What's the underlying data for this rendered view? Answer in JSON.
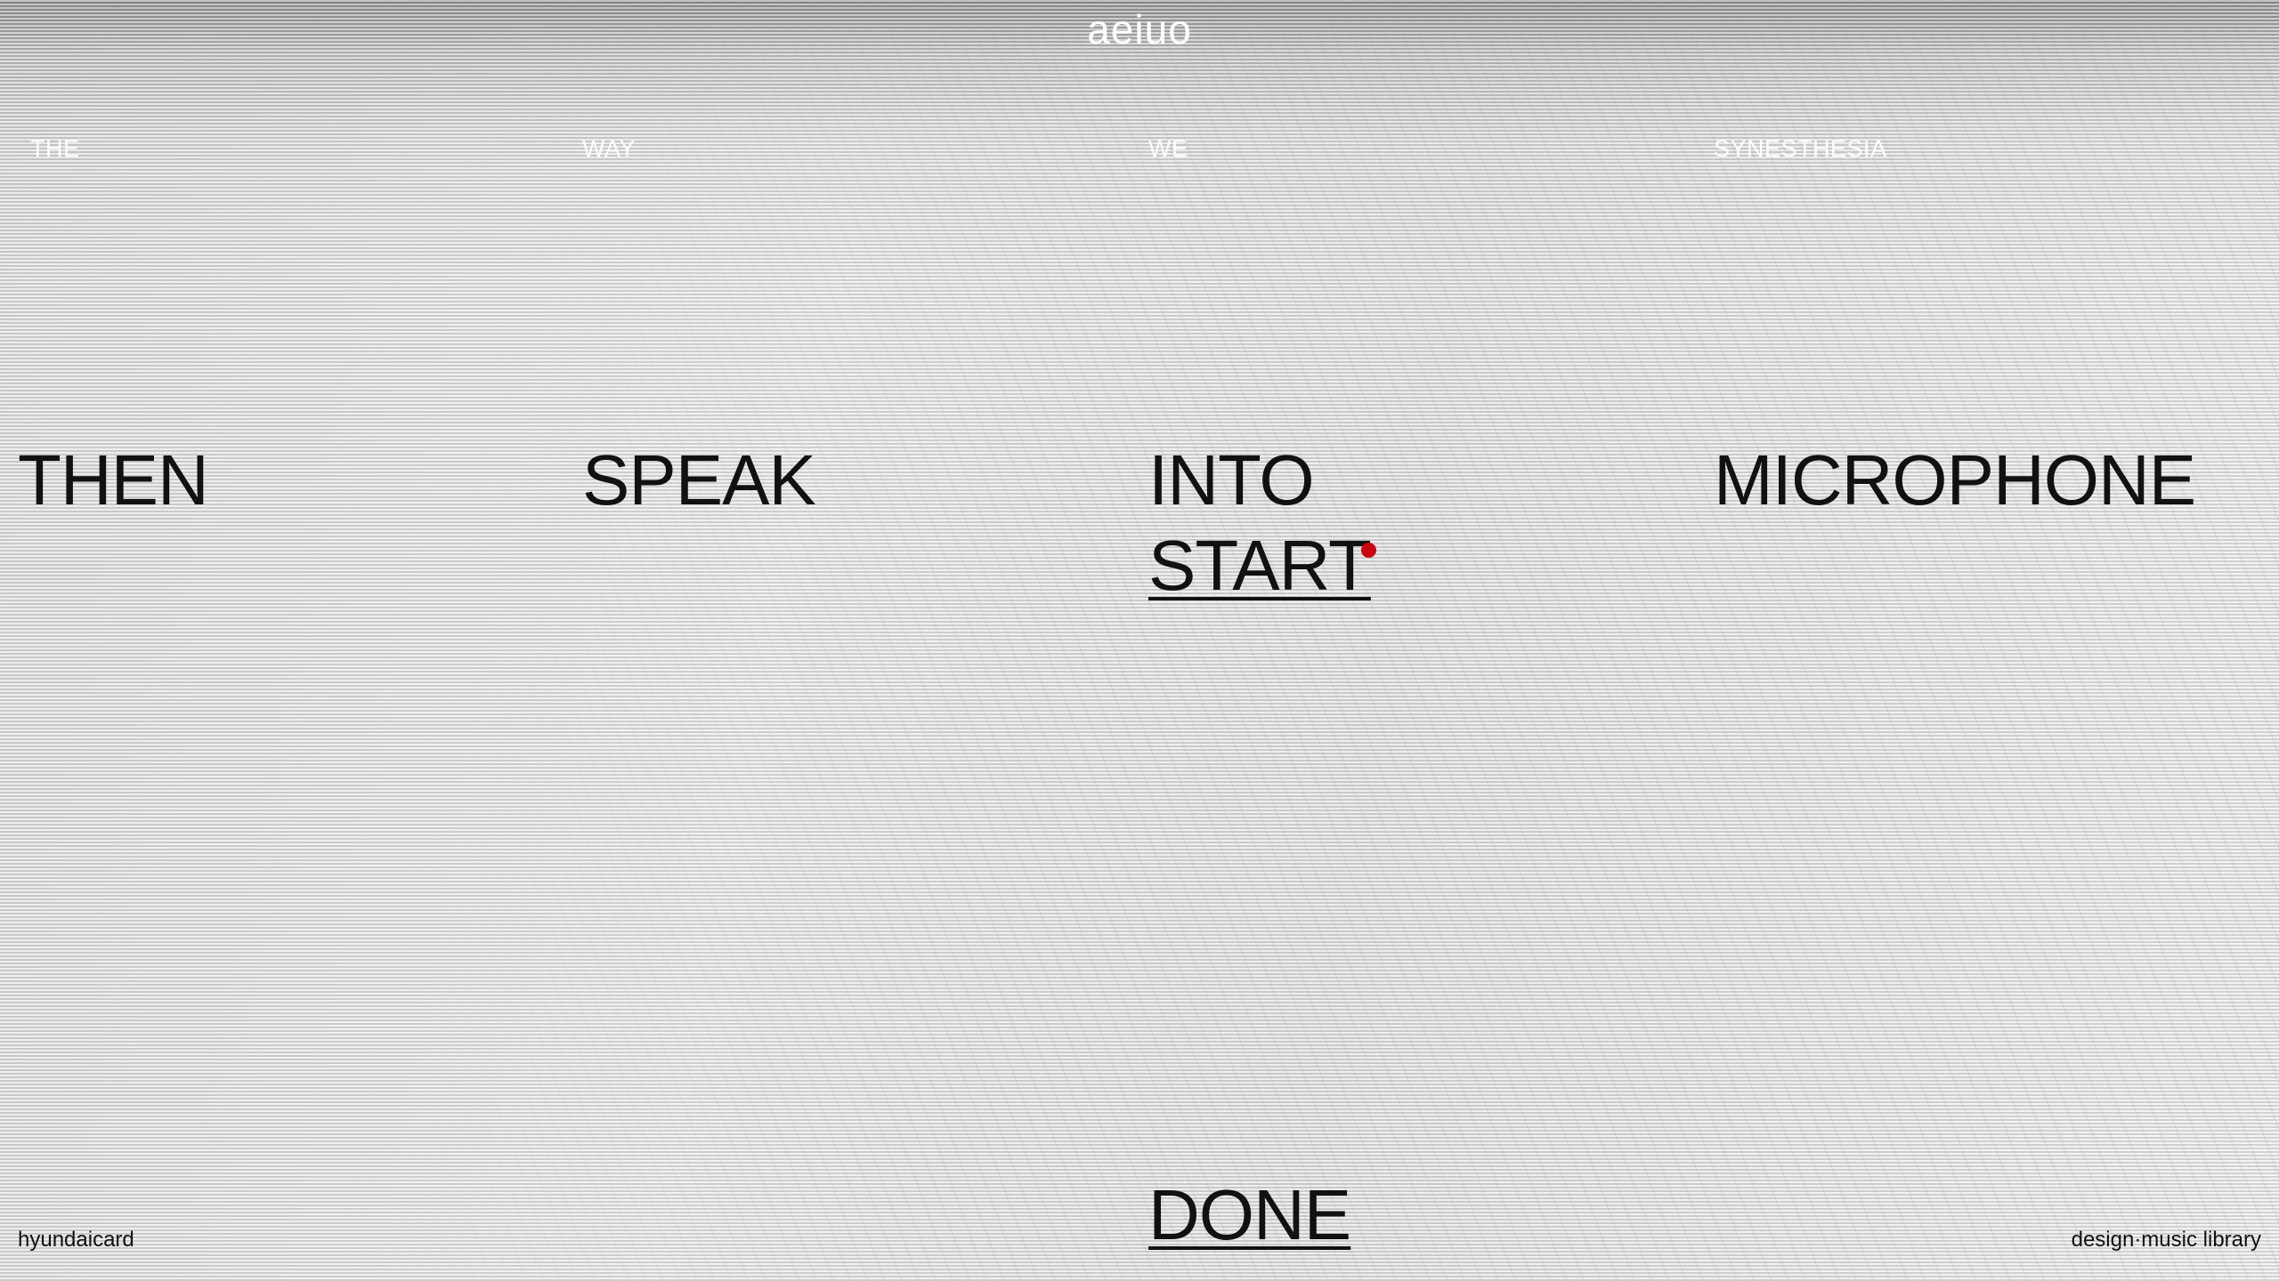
{
  "header": {
    "logo_text": "aeiuo"
  },
  "top_words": [
    "THE",
    "WAY",
    "WE",
    "SYNESTHESIA"
  ],
  "center_words": [
    "THEN",
    "SPEAK",
    "INTO",
    "MICROPHONE"
  ],
  "controls": {
    "start_label": "START",
    "done_label": "DONE",
    "record_indicator_color": "#c8000f"
  },
  "footer": {
    "left_text": "hyundaicard",
    "right_text": "design·music library"
  }
}
